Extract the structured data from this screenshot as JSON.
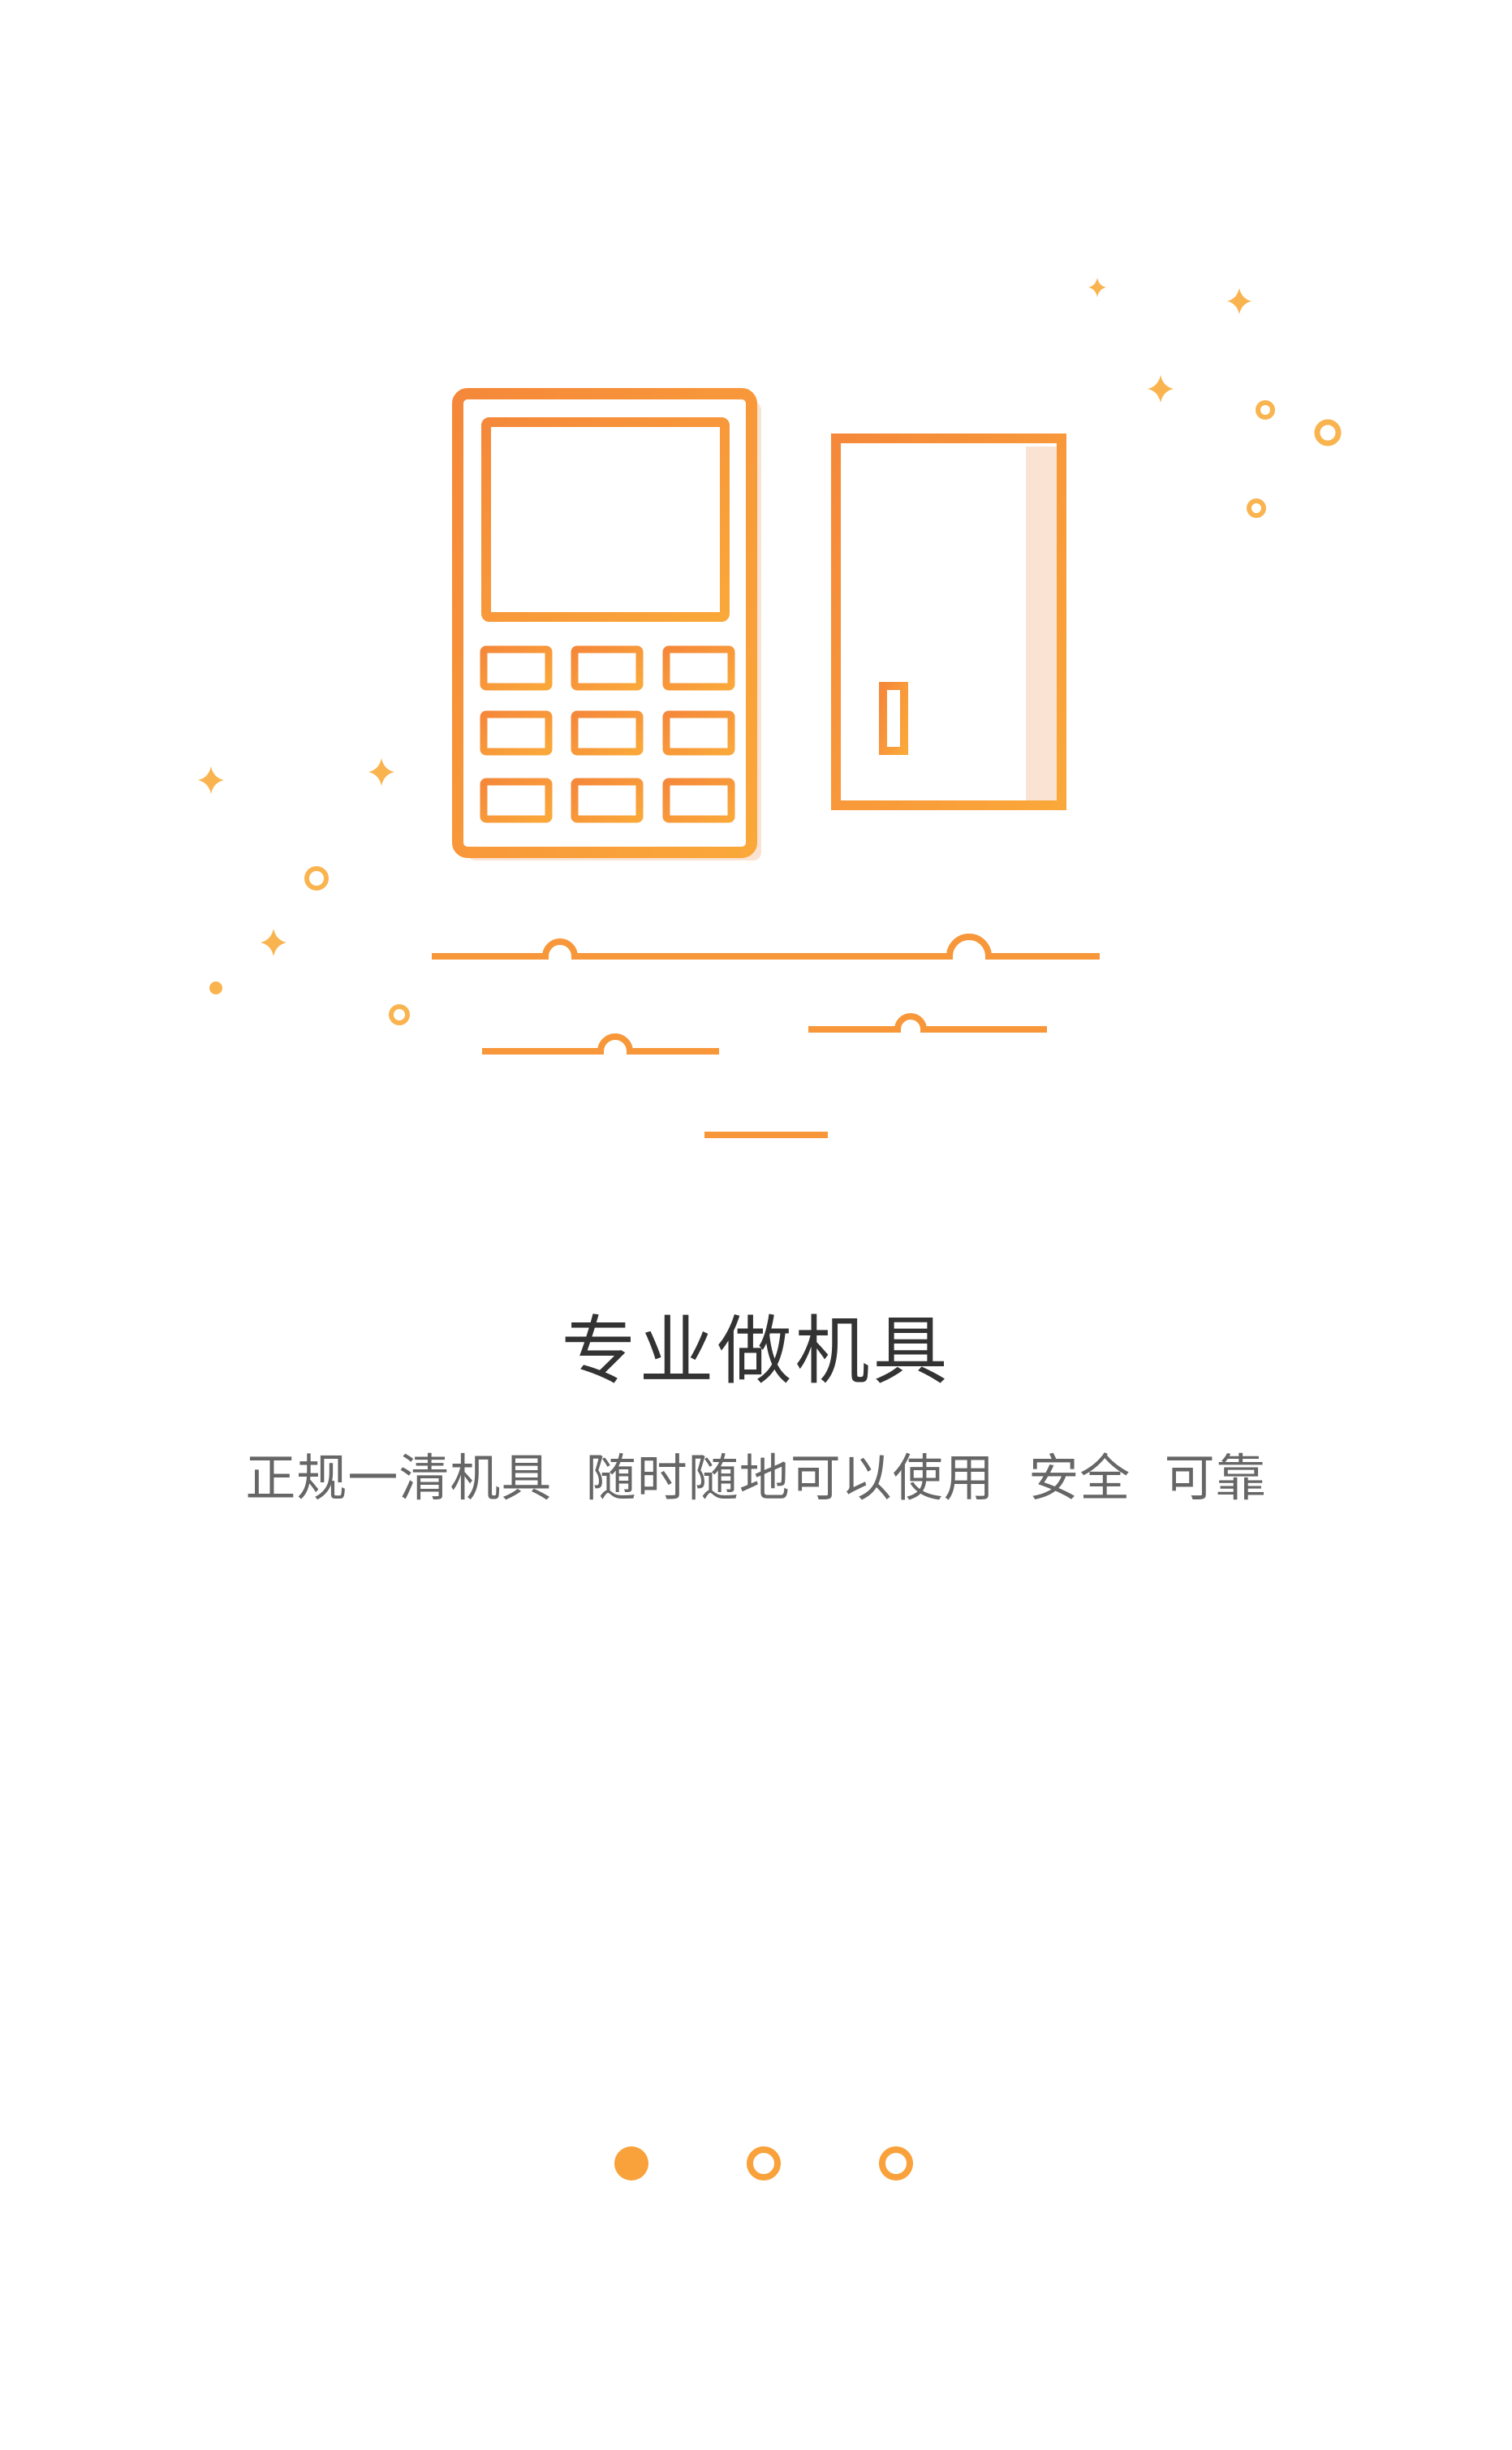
{
  "onboarding": {
    "title": "专业做机具",
    "subtitle": "正规一清机具  随时随地可以使用  安全  可靠",
    "page_indicator": {
      "pages": 3,
      "current": 1
    }
  },
  "colors": {
    "accent": "#F9A13A",
    "accent_dark": "#F28A2E",
    "shadow_tint": "#FBE3D3",
    "title_text": "#333333",
    "subtitle_text": "#666666",
    "background": "#FFFFFF"
  },
  "icons": [
    "pos-terminal-icon",
    "bank-card-icon",
    "sparkle-icon",
    "dot-icon"
  ]
}
